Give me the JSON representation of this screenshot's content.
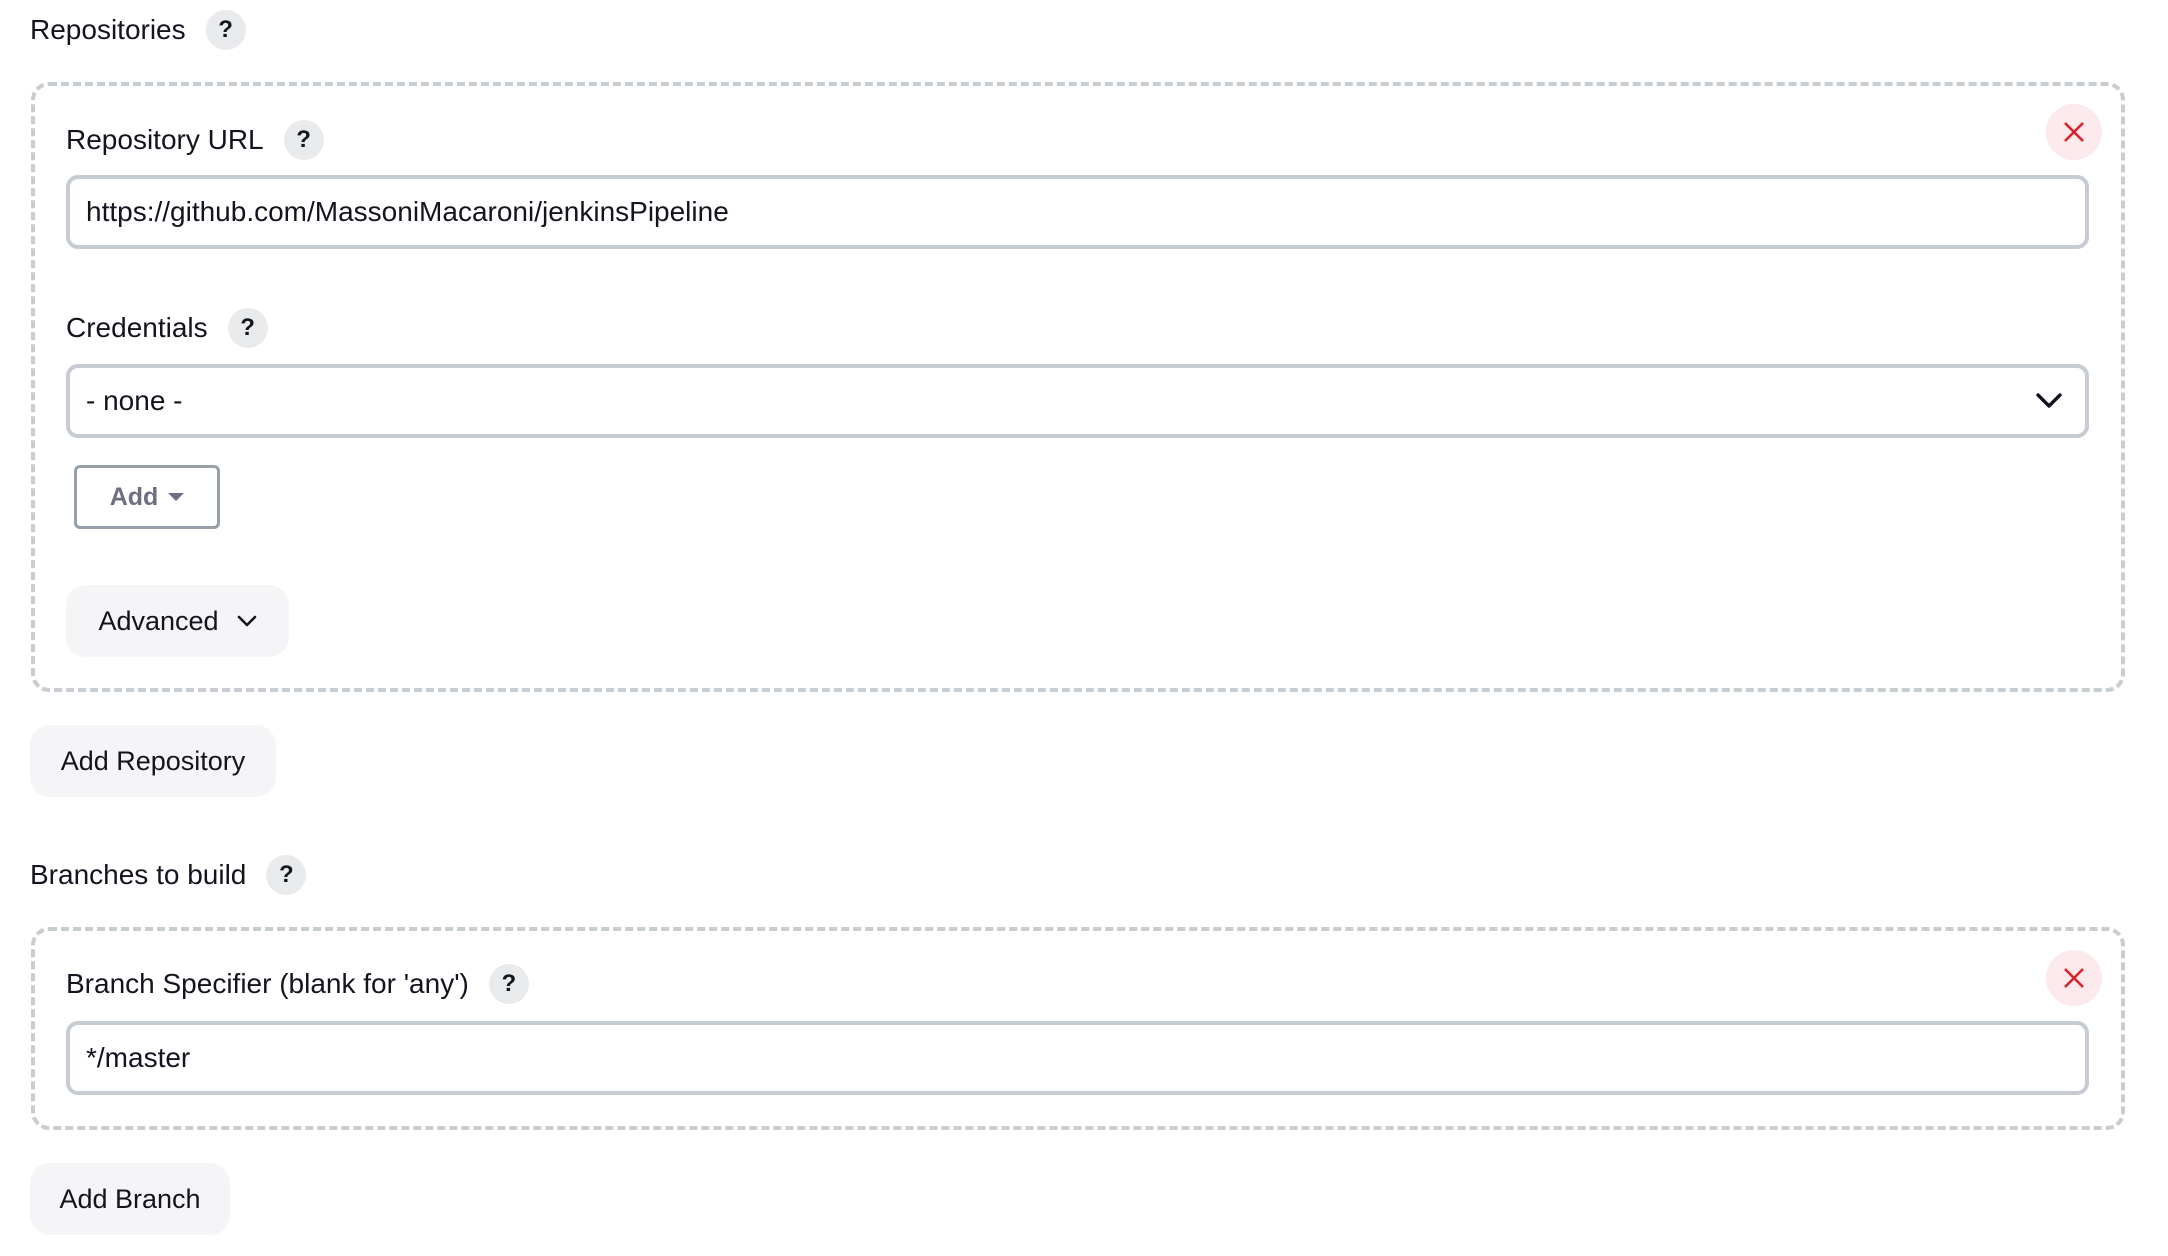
{
  "repositories": {
    "label": "Repositories",
    "help": "?",
    "items": [
      {
        "url_label": "Repository URL",
        "url_help": "?",
        "url_value": "https://github.com/MassoniMacaroni/jenkinsPipeline",
        "credentials_label": "Credentials",
        "credentials_help": "?",
        "credentials_selected": "- none -",
        "add_label": "Add",
        "advanced_label": "Advanced"
      }
    ],
    "add_repository_label": "Add Repository"
  },
  "branches": {
    "label": "Branches to build",
    "help": "?",
    "items": [
      {
        "specifier_label": "Branch Specifier (blank for 'any')",
        "specifier_help": "?",
        "specifier_value": "*/master"
      }
    ],
    "add_branch_label": "Add Branch"
  },
  "colors": {
    "close_icon": "#d9232d",
    "close_bg": "#fbe9ec",
    "border": "#c6ccd2"
  }
}
